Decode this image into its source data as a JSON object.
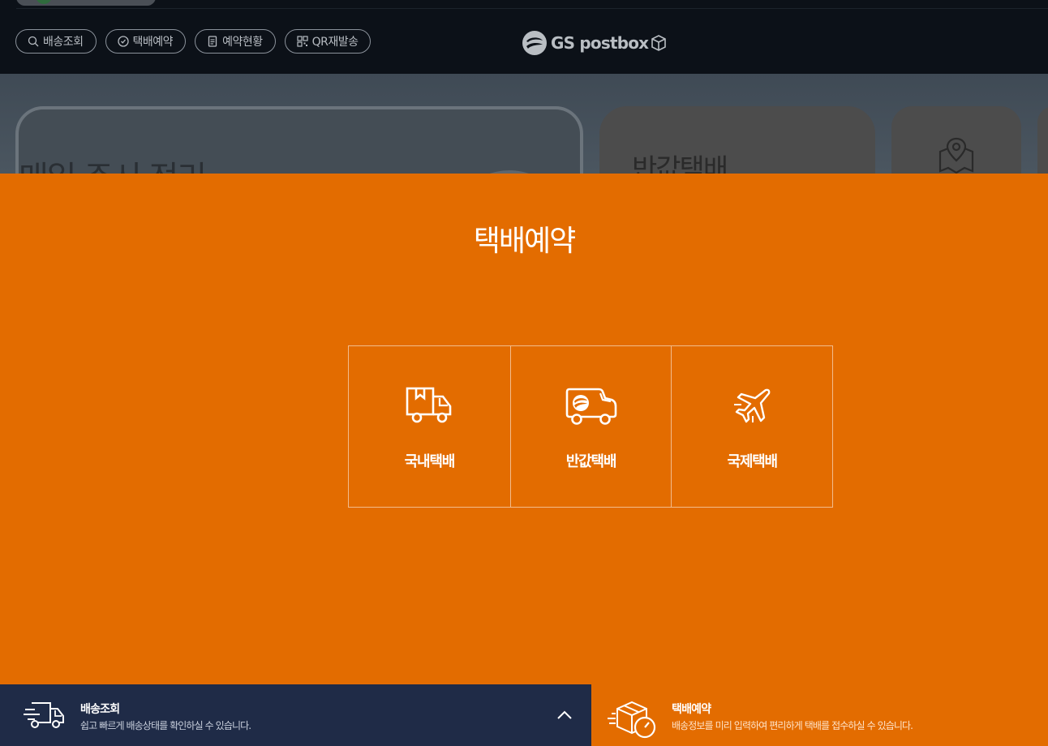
{
  "nav": {
    "items": [
      {
        "label": "배송조회",
        "icon": "search-icon"
      },
      {
        "label": "택배예약",
        "icon": "clock-icon"
      },
      {
        "label": "예약현황",
        "icon": "document-icon"
      },
      {
        "label": "QR재발송",
        "icon": "qr-code-icon"
      }
    ]
  },
  "logo": {
    "text": "GS postbox"
  },
  "hero": {
    "main_card_title": "매일 주시 정리",
    "mid_card_title": "반값택배",
    "map_card_icon": "map-pin-icon"
  },
  "modal": {
    "title": "택배예약",
    "choices": [
      {
        "label": "국내택배",
        "icon": "truck-box-icon"
      },
      {
        "label": "반값택배",
        "icon": "delivery-van-icon"
      },
      {
        "label": "국제택배",
        "icon": "airplane-icon"
      }
    ]
  },
  "bottom_bar": {
    "left": {
      "title": "배송조회",
      "description": "쉽고 빠르게 배송상태를 확인하실 수 있습니다.",
      "icon": "fast-truck-icon",
      "toggle_icon": "chevron-up-icon"
    },
    "right": {
      "title": "택배예약",
      "description": "배송정보를 미리 입력하여 편리하게 택배를 접수하실 수 있습니다.",
      "icon": "box-speed-icon"
    }
  },
  "colors": {
    "overlay_orange": "#e36c00",
    "bottom_navy": "#1f2b47",
    "topbar_dark": "#0c1118"
  }
}
